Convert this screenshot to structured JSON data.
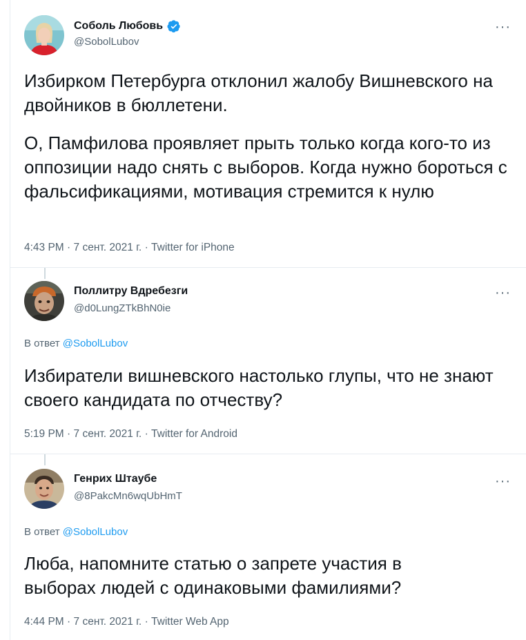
{
  "tweets": [
    {
      "author_name": "Соболь Любовь",
      "author_handle": "@SobolLubov",
      "verified": true,
      "paragraphs": [
        "Избирком Петербурга отклонил жалобу Вишневского на двойников в бюллетени.",
        "О, Памфилова проявляет прыть только когда кого-то из оппозиции надо снять с выборов. Когда нужно бороться с фальсификациями, мотивация стремится к нулю"
      ],
      "time": "4:43 PM",
      "date": "7 сент. 2021 г.",
      "source": "Twitter for iPhone",
      "more_label": "···"
    },
    {
      "author_name": "Поллитру Вдребезги",
      "author_handle": "@d0LungZTkBhN0ie",
      "reply_prefix": "В ответ",
      "reply_handle": "@SobolLubov",
      "text": "Избиратели вишневского настолько глупы, что не знают своего кандидата по отчеству?",
      "time": "5:19 PM",
      "date": "7 сент. 2021 г.",
      "source": "Twitter for Android",
      "more_label": "···"
    },
    {
      "author_name": "Генрих Штаубе",
      "author_handle": "@8PakcMn6wqUbHmT",
      "reply_prefix": "В ответ",
      "reply_handle": "@SobolLubov",
      "text": "Люба, напомните статью о запрете участия в выборах людей с одинаковыми фамилиями?",
      "time": "4:44 PM",
      "date": "7 сент. 2021 г.",
      "source": "Twitter Web App",
      "more_label": "···"
    }
  ],
  "colors": {
    "text": "#0f1419",
    "secondary": "#536471",
    "link": "#1d9bf0",
    "verified": "#1d9bf0"
  },
  "meta_separator": "·"
}
